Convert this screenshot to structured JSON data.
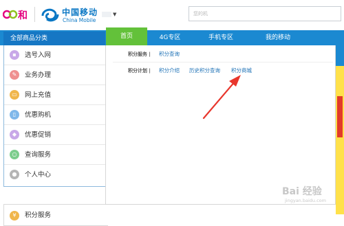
{
  "header": {
    "brand_cn": "中国移动",
    "brand_en": "China Mobile",
    "he_logo_text": "和",
    "search_placeholder": "您的机"
  },
  "nav": {
    "category_title": "全部商品分类",
    "tabs": [
      {
        "label": "首页",
        "active": true
      },
      {
        "label": "4G专区"
      },
      {
        "label": "手机专区"
      },
      {
        "label": "我的移动"
      }
    ]
  },
  "sidebar": {
    "items": [
      {
        "label": "选号入网",
        "icon": "sim-card-icon",
        "color": "#c8a8e8"
      },
      {
        "label": "业务办理",
        "icon": "pen-icon",
        "color": "#ef8f8f"
      },
      {
        "label": "网上充值",
        "icon": "wallet-icon",
        "color": "#f0b64c"
      },
      {
        "label": "优惠购机",
        "icon": "phone-icon",
        "color": "#7fb8ea"
      },
      {
        "label": "优惠促销",
        "icon": "tag-icon",
        "color": "#c8a8e8"
      },
      {
        "label": "查询服务",
        "icon": "magnifier-icon",
        "color": "#7ccd8c"
      },
      {
        "label": "个人中心",
        "icon": "user-icon",
        "color": "#b5b5b5"
      },
      {
        "label": "积分服务",
        "icon": "coin-icon",
        "color": "#f0b64c"
      }
    ]
  },
  "panel": {
    "rows": [
      {
        "category": "积分服务 |",
        "links": [
          "积分查询"
        ]
      },
      {
        "category": "积分计划 |",
        "links": [
          "积分介绍",
          "历史积分查询",
          "积分商城"
        ]
      }
    ]
  },
  "watermark": {
    "main": "Bai 经验",
    "sub": "jingyan.baidu.com"
  },
  "colors": {
    "nav_blue": "#1b89d1",
    "home_green": "#63c13a",
    "link_blue": "#1a6fb5",
    "arrow_red": "#e8362c"
  }
}
